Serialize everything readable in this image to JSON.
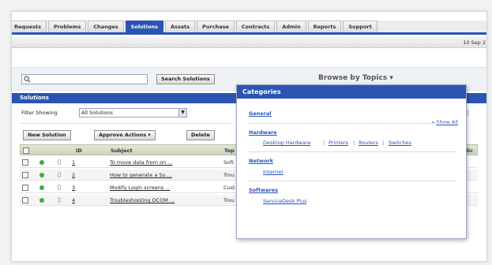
{
  "tabs": [
    "Requests",
    "Problems",
    "Changes",
    "Solutions",
    "Assets",
    "Purchase",
    "Contracts",
    "Admin",
    "Reports",
    "Support"
  ],
  "active_tab": "Solutions",
  "date": "10 Sep 2",
  "search": {
    "value": "",
    "button": "Search Solutions"
  },
  "browse": "Browse by Topics",
  "solutions_header": "Solutions",
  "filter": {
    "label": "Filter Showing",
    "selected": "All Solutions"
  },
  "toolbar": {
    "new": "New Solution",
    "approve": "Approve Actions",
    "delete": "Delete"
  },
  "pager": "|",
  "columns": {
    "id": "ID",
    "subject": "Subject",
    "topic": "Top",
    "public": "blic"
  },
  "rows": [
    {
      "id": "1",
      "subject": "To move data from on ...",
      "topic": "Soft"
    },
    {
      "id": "2",
      "subject": "How to generate a Su ...",
      "topic": "Trou"
    },
    {
      "id": "3",
      "subject": "Modify Login screens ...",
      "topic": "Cust"
    },
    {
      "id": "4",
      "subject": "Troubleshooting DCOM ...",
      "topic": "Trou"
    }
  ],
  "categories": {
    "title": "Categories",
    "show_all": "Show All",
    "groups": [
      {
        "name": "General",
        "items": []
      },
      {
        "name": "Hardware",
        "items": [
          "Desktop Hardware",
          "Printers",
          "Routers",
          "Switches"
        ]
      },
      {
        "name": "Network",
        "items": [
          "Internet"
        ]
      },
      {
        "name": "Softwares",
        "items": [
          "ServiceDesk Plus"
        ]
      }
    ]
  },
  "colors": {
    "accent": "#2a55b3",
    "status_green": "#3fae3f"
  }
}
